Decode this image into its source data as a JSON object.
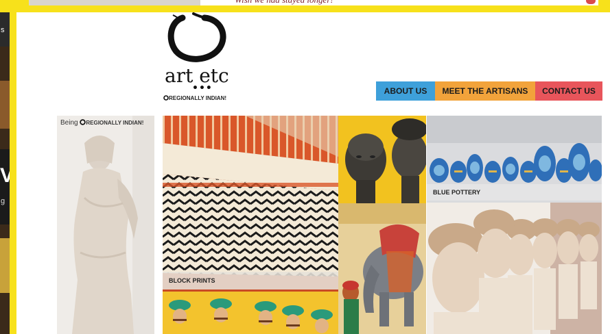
{
  "top_banner": {
    "text": "Wish we had stayed longer!"
  },
  "left_strip": {
    "letter": "V",
    "small_text_1": "s",
    "small_text_2": "g"
  },
  "logo": {
    "name": "art etc",
    "dots": "•••",
    "tagline": "REGIONALLY INDIAN!"
  },
  "nav": [
    {
      "label": "ABOUT US",
      "color": "#3ea0da"
    },
    {
      "label": "MEET THE ARTISANS",
      "color": "#f2a33b"
    },
    {
      "label": "CONTACT US",
      "color": "#e8555b"
    }
  ],
  "side_banner": {
    "prefix": "Being",
    "brand": "REGIONALLY INDIAN!"
  },
  "tiles": {
    "block_prints": {
      "label": "BLOCK PRINTS"
    },
    "blue_pottery": {
      "label": "BLUE POTTERY"
    }
  },
  "colors": {
    "frame": "#f7e11b",
    "nav_blue": "#3ea0da",
    "nav_orange": "#f2a33b",
    "nav_red": "#e8555b"
  }
}
